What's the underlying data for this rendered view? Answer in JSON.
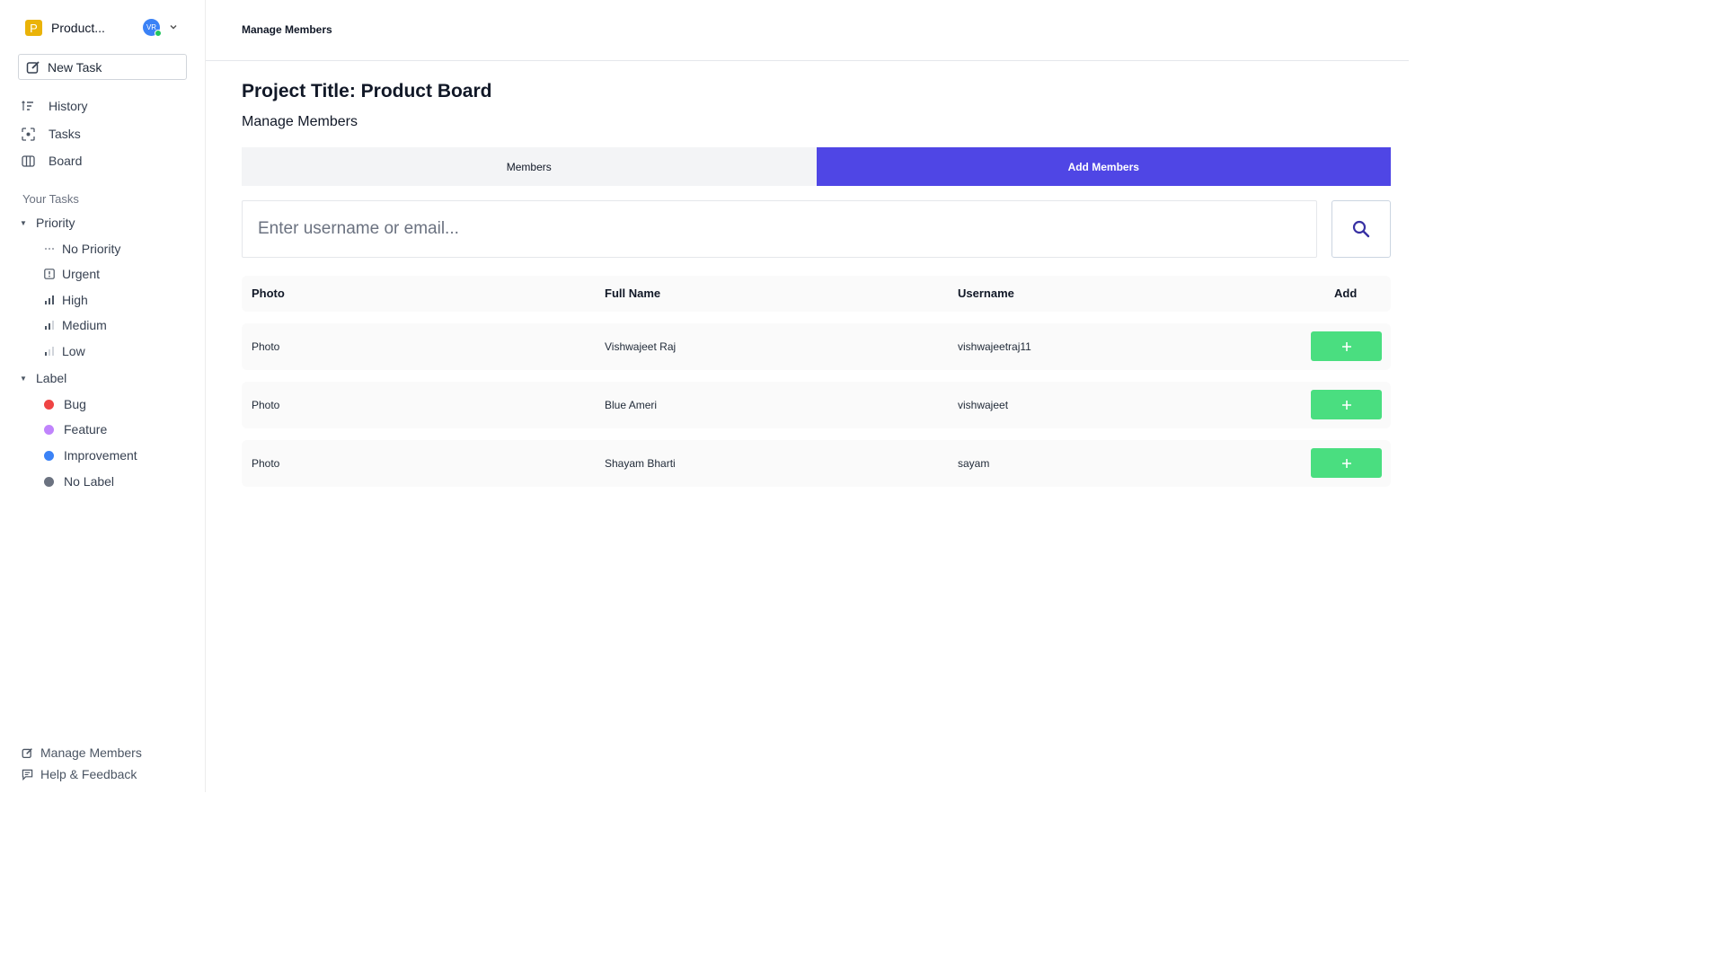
{
  "workspace": {
    "logo_letter": "P",
    "name": "Product...",
    "avatar_initials": "VR"
  },
  "sidebar": {
    "new_task": "New Task",
    "nav": [
      {
        "label": "History",
        "icon": "history-icon"
      },
      {
        "label": "Tasks",
        "icon": "tasks-icon"
      },
      {
        "label": "Board",
        "icon": "board-icon"
      }
    ],
    "section_title": "Your Tasks",
    "priority": {
      "label": "Priority",
      "items": [
        {
          "label": "No Priority",
          "icon": "no-priority-icon"
        },
        {
          "label": "Urgent",
          "icon": "urgent-icon"
        },
        {
          "label": "High",
          "icon": "high-priority-icon"
        },
        {
          "label": "Medium",
          "icon": "medium-priority-icon"
        },
        {
          "label": "Low",
          "icon": "low-priority-icon"
        }
      ]
    },
    "label_group": {
      "label": "Label",
      "items": [
        {
          "label": "Bug",
          "color": "#ef4444"
        },
        {
          "label": "Feature",
          "color": "#c084fc"
        },
        {
          "label": "Improvement",
          "color": "#3b82f6"
        },
        {
          "label": "No Label",
          "color": "#6b7280"
        }
      ]
    },
    "bottom": {
      "manage_members": "Manage Members",
      "help": "Help & Feedback"
    }
  },
  "header": {
    "breadcrumb": "Manage Members"
  },
  "main": {
    "project_title": "Project Title: Product Board",
    "subtitle": "Manage Members",
    "tabs": [
      {
        "label": "Members",
        "active": false
      },
      {
        "label": "Add Members",
        "active": true
      }
    ],
    "search": {
      "placeholder": "Enter username or email...",
      "value": ""
    },
    "table": {
      "headers": {
        "photo": "Photo",
        "full_name": "Full Name",
        "username": "Username",
        "add": "Add"
      },
      "rows": [
        {
          "photo": "Photo",
          "full_name": "Vishwajeet Raj",
          "username": "vishwajeetraj11"
        },
        {
          "photo": "Photo",
          "full_name": "Blue Ameri",
          "username": "vishwajeet"
        },
        {
          "photo": "Photo",
          "full_name": "Shayam Bharti",
          "username": "sayam"
        }
      ]
    }
  },
  "colors": {
    "accent": "#4f46e5",
    "add_button": "#4ade80",
    "workspace_logo": "#eab308"
  }
}
